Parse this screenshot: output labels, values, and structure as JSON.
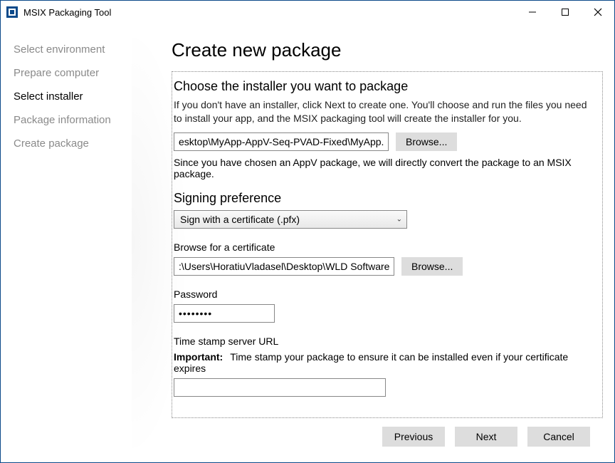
{
  "window": {
    "title": "MSIX Packaging Tool"
  },
  "sidebar": {
    "items": [
      {
        "label": "Select environment",
        "active": false
      },
      {
        "label": "Prepare computer",
        "active": false
      },
      {
        "label": "Select installer",
        "active": true
      },
      {
        "label": "Package information",
        "active": false
      },
      {
        "label": "Create package",
        "active": false
      }
    ]
  },
  "main": {
    "heading": "Create new package",
    "installer": {
      "section_title": "Choose the installer you want to package",
      "description": "If you don't have an installer, click Next to create one. You'll choose and run the files you need to install your app, and the MSIX packaging tool will create the installer for you.",
      "path_value": "esktop\\MyApp-AppV-Seq-PVAD-Fixed\\MyApp.appv",
      "browse_label": "Browse...",
      "appv_note": "Since you have chosen an AppV package, we will directly convert the package to an MSIX package."
    },
    "signing": {
      "section_title": "Signing preference",
      "dropdown_value": "Sign with a certificate (.pfx)",
      "browse_cert_label": "Browse for a certificate",
      "cert_path_value": ":\\Users\\HoratiuVladasel\\Desktop\\WLD Software.pfx",
      "browse_button": "Browse...",
      "password_label": "Password",
      "password_value": "••••••••",
      "timestamp_label": "Time stamp server URL",
      "important_label": "Important:",
      "important_text": "Time stamp your package to ensure it can be installed even if your certificate expires",
      "timestamp_value": ""
    }
  },
  "footer": {
    "previous": "Previous",
    "next": "Next",
    "cancel": "Cancel"
  }
}
